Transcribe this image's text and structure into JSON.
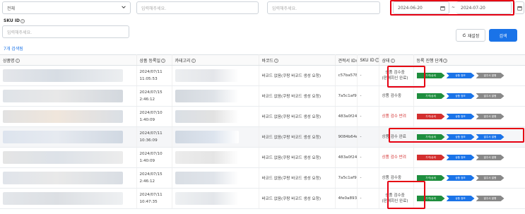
{
  "filters": {
    "select_value": "전체",
    "input1_placeholder": "입력해주세요.",
    "input2_placeholder": "입력해주세요.",
    "date_from": "2024-06-20",
    "date_sep": "~",
    "date_to": "2024-07-20",
    "sku_label": "SKU ID",
    "sku_placeholder": "입력해주세요.",
    "reset_label": "재설정",
    "search_label": "검색"
  },
  "count_text": "7개 검색됨",
  "table": {
    "headers": [
      "상품명",
      "상품 등록일",
      "카테고리",
      "바코드",
      "견적서 ID",
      "SKU ID",
      "상태",
      "등록 진행 단계"
    ],
    "rows": [
      {
        "date": "2024/07/11",
        "time": "11:05:53",
        "barcode": "바코드 없음(쿠팡 바코드 생성 요청)",
        "quote_id": "c57ba578...",
        "sku": "-",
        "status1": "상품 검수중",
        "status2": "(판매회신 완료)",
        "status_color": "normal",
        "steps": [
          "가격/상세",
          "상품 정보",
          "발주서 발행"
        ],
        "step_colors": [
          "green",
          "blue",
          "gray"
        ]
      },
      {
        "date": "2024/07/15",
        "time": "2:46:12",
        "barcode": "바코드 없음(쿠팡 바코드 생성 요청)",
        "quote_id": "7a5c1af9...",
        "sku": "-",
        "status1": "상품 검수중",
        "status2": "",
        "status_color": "normal",
        "steps": [
          "가격/상세",
          "상품 정보",
          "발주서 발행"
        ],
        "step_colors": [
          "green",
          "blue",
          "gray"
        ]
      },
      {
        "date": "2024/07/10",
        "time": "1:40:09",
        "barcode": "바코드 없음(쿠팡 바코드 생성 요청)",
        "quote_id": "483a0f24...",
        "sku": "-",
        "status1": "상품 검수 반려",
        "status2": "",
        "status_color": "red",
        "steps": [
          "가격/상세",
          "상품 정보",
          "발주서 발행"
        ],
        "step_colors": [
          "red",
          "blue",
          "gray"
        ]
      },
      {
        "date": "2024/07/11",
        "time": "10:36:09",
        "barcode": "바코드 없음(쿠팡 바코드 생성 요청)",
        "quote_id": "9084b64e...",
        "sku": "-",
        "status1": "상품 검수 완료",
        "status2": "",
        "status_color": "normal",
        "steps": [
          "가격/상세",
          "상품 정보",
          "발주서 발행"
        ],
        "step_colors": [
          "green",
          "blue",
          "blue"
        ]
      },
      {
        "date": "2024/07/10",
        "time": "1:40:09",
        "barcode": "바코드 없음(쿠팡 바코드 생성 요청)",
        "quote_id": "483a0f24...",
        "sku": "-",
        "status1": "상품 검수 반려",
        "status2": "",
        "status_color": "red",
        "steps": [
          "가격/상세",
          "상품 정보",
          "발주서 발행"
        ],
        "step_colors": [
          "red",
          "blue",
          "gray"
        ]
      },
      {
        "date": "2024/07/15",
        "time": "2:46:12",
        "barcode": "바코드 없음(쿠팡 바코드 생성 요청)",
        "quote_id": "7a5c1af9...",
        "sku": "-",
        "status1": "상품 검수중",
        "status2": "",
        "status_color": "normal",
        "steps": [
          "가격/상세",
          "상품 정보",
          "발주서 발행"
        ],
        "step_colors": [
          "green",
          "blue",
          "gray"
        ]
      },
      {
        "date": "2024/07/11",
        "time": "10:47:35",
        "barcode": "바코드 없음(쿠팡 바코드 생성 요청)",
        "quote_id": "4fe0a893...",
        "sku": "-",
        "status1": "상품 검수중",
        "status2": "(판매회신 완료)",
        "status_color": "normal",
        "steps": [
          "가격/상세",
          "상품 정보",
          "발주서 발행"
        ],
        "step_colors": [
          "green",
          "blue",
          "gray"
        ]
      }
    ]
  },
  "colors": {
    "accent": "#1a73e8",
    "highlight_box": "#e60012",
    "green": "#1e8e3e",
    "red": "#d32f2f",
    "gray": "#888888"
  }
}
